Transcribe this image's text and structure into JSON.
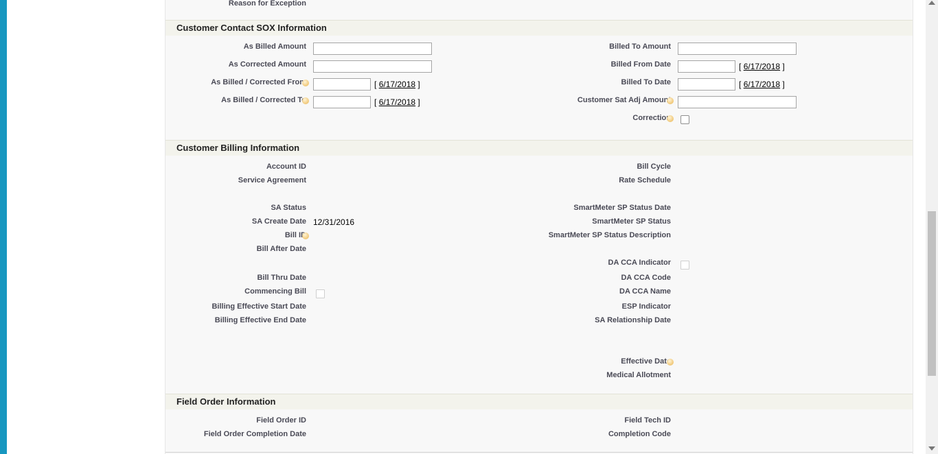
{
  "top_partial": {
    "reason_label": "Reason for Exception"
  },
  "sox": {
    "title": "Customer Contact SOX Information",
    "as_billed_amount": "As Billed Amount",
    "as_corrected_amount": "As Corrected Amount",
    "as_billed_corrected_from": "As Billed / Corrected From",
    "as_billed_corrected_to": "As Billed / Corrected To",
    "billed_to_amount": "Billed To Amount",
    "billed_from_date": "Billed From Date",
    "billed_to_date": "Billed To Date",
    "customer_sat_adj_amount": "Customer Sat Adj Amount",
    "correction": "Correction",
    "today_link": "6/17/2018",
    "bracket_open": "[",
    "bracket_close": "]",
    "inputs": {
      "as_billed_amount": "",
      "as_corrected_amount": "",
      "from": "",
      "to": "",
      "billed_to_amount": "",
      "billed_from_date": "",
      "billed_to_date": "",
      "customer_sat_adj_amount": ""
    },
    "correction_checked": false
  },
  "billing": {
    "title": "Customer Billing Information",
    "account_id": "Account ID",
    "service_agreement": "Service Agreement",
    "sa_status": "SA Status",
    "sa_create_date": "SA Create Date",
    "sa_create_date_value": "12/31/2016",
    "bill_id": "Bill ID",
    "bill_after_date": "Bill After Date",
    "bill_thru_date": "Bill Thru Date",
    "commencing_bill": "Commencing Bill",
    "billing_effective_start_date": "Billing Effective Start Date",
    "billing_effective_end_date": "Billing Effective End Date",
    "bill_cycle": "Bill Cycle",
    "rate_schedule": "Rate Schedule",
    "smartmeter_sp_status_date": "SmartMeter SP Status Date",
    "smartmeter_sp_status": "SmartMeter SP Status",
    "smartmeter_sp_status_description": "SmartMeter SP Status Description",
    "da_cca_indicator": "DA CCA Indicator",
    "da_cca_code": "DA CCA Code",
    "da_cca_name": "DA CCA Name",
    "esp_indicator": "ESP Indicator",
    "sa_relationship_date": "SA Relationship Date",
    "effective_date": "Effective Date",
    "medical_allotment": "Medical Allotment"
  },
  "field_order": {
    "title": "Field Order Information",
    "field_order_id": "Field Order ID",
    "field_order_completion_date": "Field Order Completion Date",
    "field_tech_id": "Field Tech ID",
    "completion_code": "Completion Code"
  },
  "colors": {
    "sidebar": "#1797c0",
    "section_header": "#f3f3ec",
    "panel": "#f8f8f8"
  },
  "icons": {
    "help": "help-info-icon"
  }
}
